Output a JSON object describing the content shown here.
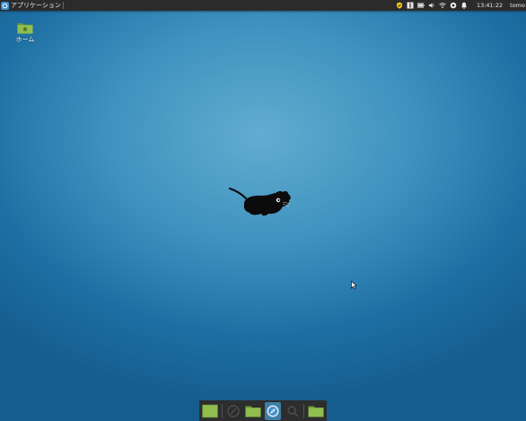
{
  "panel": {
    "applications_label": "アプリケーション",
    "clock": "13:41:22",
    "user": "tomo"
  },
  "desktop": {
    "home_label": "ホーム"
  },
  "tray_icons": [
    "shield-icon",
    "keyboard-icon",
    "battery-icon",
    "volume-icon",
    "wifi-icon",
    "power-icon",
    "notification-bell-icon"
  ],
  "dock_items": [
    "show-desktop-icon",
    "terminal-icon",
    "folder-icon",
    "web-browser-icon",
    "search-icon",
    "folder-icon"
  ],
  "colors": {
    "panel_bg": "#2b2b2b",
    "folder_green": "#8fbd4e",
    "accent_blue": "#3d8fd1"
  }
}
